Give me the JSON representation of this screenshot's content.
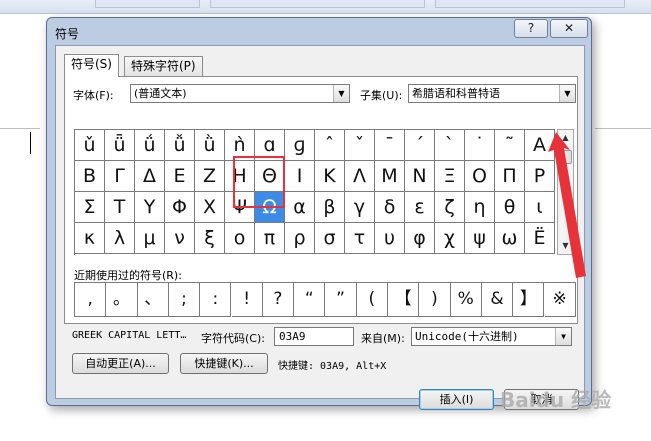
{
  "dialog": {
    "title": "符号",
    "help_label": "?",
    "close_label": "✕"
  },
  "tabs": [
    {
      "label": "符号(S)"
    },
    {
      "label": "特殊字符(P)"
    }
  ],
  "font": {
    "label": "字体(F):",
    "value": "(普通文本)"
  },
  "subset": {
    "label": "子集(U):",
    "value": "希腊语和科普特语"
  },
  "symbol_grid": {
    "rows": [
      [
        "ǔ",
        "ǖ",
        "ǘ",
        "ǚ",
        "ǜ",
        "ǹ",
        "ɑ",
        "ɡ",
        "ˆ",
        "ˇ",
        "ˉ",
        "ˊ",
        "ˋ",
        "˙",
        "˜",
        "A"
      ],
      [
        "Β",
        "Γ",
        "Δ",
        "Ε",
        "Ζ",
        "Η",
        "Θ",
        "Ι",
        "Κ",
        "Λ",
        "Μ",
        "Ν",
        "Ξ",
        "Ο",
        "Π",
        "Ρ"
      ],
      [
        "Σ",
        "Τ",
        "Υ",
        "Φ",
        "Χ",
        "Ψ",
        "Ω",
        "α",
        "β",
        "γ",
        "δ",
        "ε",
        "ζ",
        "η",
        "θ",
        "ι"
      ],
      [
        "κ",
        "λ",
        "μ",
        "ν",
        "ξ",
        "ο",
        "π",
        "ρ",
        "σ",
        "τ",
        "υ",
        "φ",
        "χ",
        "ψ",
        "ω",
        "Ë"
      ]
    ],
    "selected": "Ω"
  },
  "recent": {
    "label": "近期使用过的符号(R):",
    "symbols": [
      ",",
      "。",
      "、",
      ";",
      ":",
      "!",
      "?",
      "“",
      "”",
      "(",
      "【",
      ")",
      "%",
      "&",
      "】",
      "※"
    ]
  },
  "char_name": "GREEK CAPITAL LETT…",
  "char_code": {
    "label": "字符代码(C):",
    "value": "03A9"
  },
  "from": {
    "label": "来自(M):",
    "value": "Unicode(十六进制)"
  },
  "buttons": {
    "autocorrect": "自动更正(A)...",
    "shortcut_key": "快捷键(K)...",
    "insert": "插入(I)",
    "cancel": "取消"
  },
  "shortcut_text": "快捷键: 03A9, Alt+X",
  "watermark": "Baidu 经验",
  "colors": {
    "selection": "#3c8ce7",
    "annotation": "#e8323a"
  }
}
